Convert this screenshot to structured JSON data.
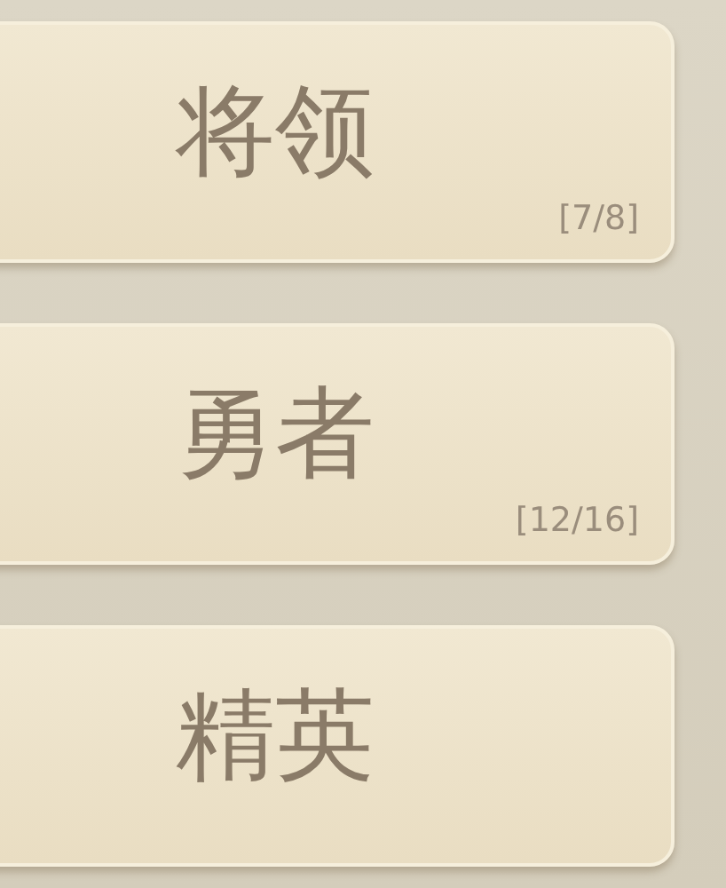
{
  "buttons": [
    {
      "label": "将领",
      "count": "[7/8]"
    },
    {
      "label": "勇者",
      "count": "[12/16]"
    },
    {
      "label": "精英"
    }
  ]
}
